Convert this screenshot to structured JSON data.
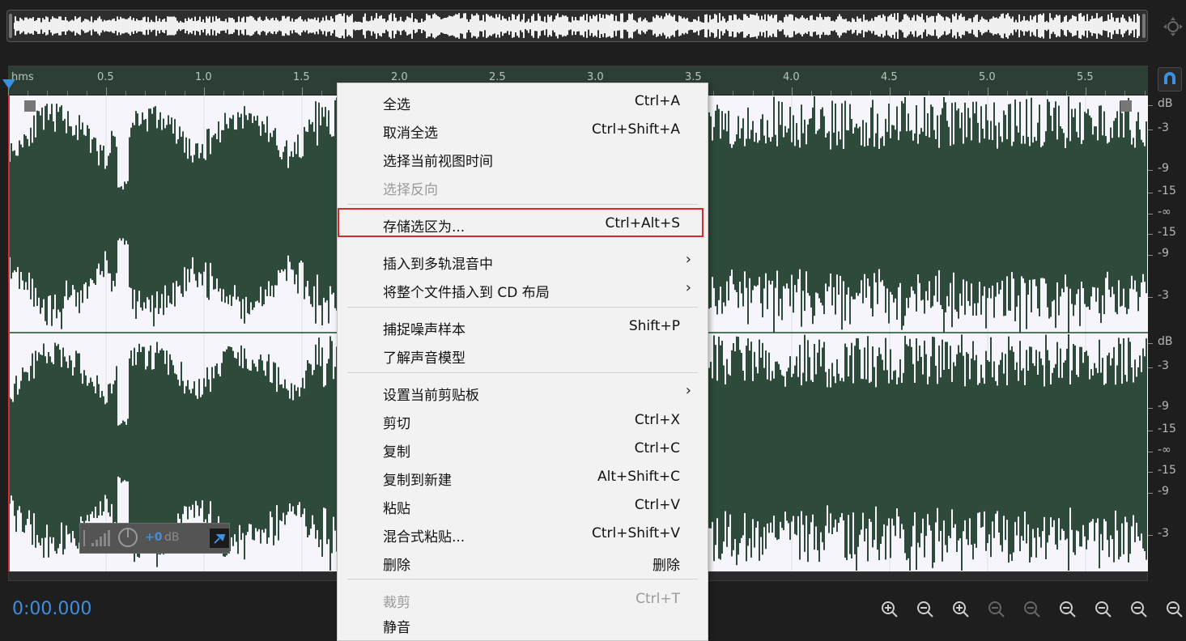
{
  "ruler": {
    "unit_label": "hms",
    "ticks": [
      "0.5",
      "1.0",
      "1.5",
      "2.0",
      "2.5",
      "3.0",
      "3.5",
      "4.0",
      "4.5",
      "5.0",
      "5.5"
    ]
  },
  "db_scale": {
    "top_channel": [
      "dB",
      "-3",
      "-9",
      "-15",
      "-∞",
      "-15",
      "-9",
      "-3"
    ],
    "bottom_channel": [
      "dB",
      "-3",
      "-9",
      "-15",
      "-∞",
      "-15",
      "-9",
      "-3"
    ]
  },
  "hud": {
    "gain_value": "+0",
    "gain_unit": "dB"
  },
  "transport": {
    "current_time": "0:00.000"
  },
  "colors": {
    "waveform": "#2d4a3a",
    "waveform_bg": "#f5f5fb",
    "accent": "#3d8fe0",
    "highlight": "#d42b2b"
  },
  "context_menu": {
    "items": [
      {
        "label": "全选",
        "shortcut": "Ctrl+A",
        "enabled": true
      },
      {
        "label": "取消全选",
        "shortcut": "Ctrl+Shift+A",
        "enabled": true
      },
      {
        "label": "选择当前视图时间",
        "shortcut": "",
        "enabled": true
      },
      {
        "label": "选择反向",
        "shortcut": "",
        "enabled": false
      },
      {
        "label": "存储选区为...",
        "shortcut": "Ctrl+Alt+S",
        "enabled": true,
        "highlighted": true
      },
      {
        "label": "插入到多轨混音中",
        "shortcut": "",
        "enabled": true,
        "submenu": true
      },
      {
        "label": "将整个文件插入到 CD 布局",
        "shortcut": "",
        "enabled": true,
        "submenu": true
      },
      {
        "label": "捕捉噪声样本",
        "shortcut": "Shift+P",
        "enabled": true
      },
      {
        "label": "了解声音模型",
        "shortcut": "",
        "enabled": true
      },
      {
        "label": "设置当前剪贴板",
        "shortcut": "",
        "enabled": true,
        "submenu": true
      },
      {
        "label": "剪切",
        "shortcut": "Ctrl+X",
        "enabled": true
      },
      {
        "label": "复制",
        "shortcut": "Ctrl+C",
        "enabled": true
      },
      {
        "label": "复制到新建",
        "shortcut": "Alt+Shift+C",
        "enabled": true
      },
      {
        "label": "粘贴",
        "shortcut": "Ctrl+V",
        "enabled": true
      },
      {
        "label": "混合式粘贴...",
        "shortcut": "Ctrl+Shift+V",
        "enabled": true
      },
      {
        "label": "删除",
        "shortcut": "删除",
        "enabled": true
      },
      {
        "label": "裁剪",
        "shortcut": "Ctrl+T",
        "enabled": false
      },
      {
        "label": "静音",
        "shortcut": "",
        "enabled": true
      }
    ],
    "submenu_arrow": "›"
  },
  "icons": {
    "zoom_nav": "zoom-navigator-icon",
    "snap": "magnet-snap-icon",
    "zoom_buttons": [
      "zoom-in-amplitude-icon",
      "zoom-out-amplitude-icon",
      "zoom-in-time-icon",
      "zoom-out-time-icon",
      "zoom-full-icon",
      "zoom-in-left-icon",
      "zoom-in-right-icon",
      "zoom-selection-icon",
      "zoom-reset-icon"
    ]
  }
}
